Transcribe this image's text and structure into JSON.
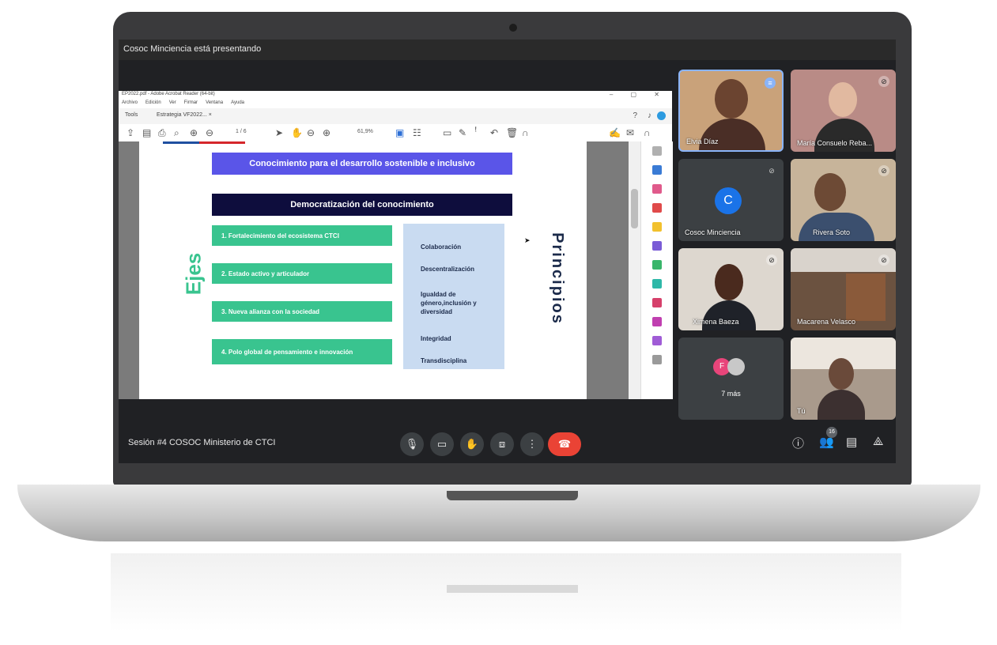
{
  "meet": {
    "presenting_text": "Cosoc Minciencia está presentando",
    "meeting_title": "Sesión #4 COSOC Ministerio de CTCI",
    "people_count": "16"
  },
  "acrobat": {
    "title": "EP2022.pdf - Adobe Acrobat Reader (64-bit)",
    "menu": [
      "Archivo",
      "Edición",
      "Ver",
      "Firmar",
      "Ventana",
      "Ayuda"
    ],
    "tab_tools": "Tools",
    "tab_doc": "Estrategia VF2022... ×",
    "page_counter": "1 / 6",
    "zoom": "61,9%"
  },
  "slide": {
    "banner_top": "Conocimiento para el desarrollo sostenible e inclusivo",
    "banner_dark": "Democratización del conocimiento",
    "ejes_label": "Ejes",
    "principios_label": "Principios",
    "ejes": [
      "1. Fortalecimiento del ecosistema CTCI",
      "2. Estado activo y articulador",
      "3. Nueva alianza con la sociedad",
      "4. Polo global de pensamiento e innovación"
    ],
    "principios": [
      "Colaboración",
      "Descentralización",
      "Igualdad de género,inclusión y diversidad",
      "Integridad",
      "Transdisciplina"
    ]
  },
  "participants": {
    "tile1": "Elvia Díaz",
    "tile2": "María Consuelo Reba...",
    "tile3": "Cosoc Minciencia",
    "tile3_avatar": "C",
    "tile4": "Rivera Soto",
    "tile5": "Ximena Baeza",
    "tile6": "Macarena Velasco",
    "tile7": "7 más",
    "tile7_avatar": "F",
    "tile8": "Tú"
  },
  "colors": {
    "accent_blue": "#5a55e8",
    "dark_navy": "#0e0d3d",
    "eje_green": "#39c48f",
    "principles_bg": "#c9dbf1",
    "end_call_red": "#ea4335",
    "avatar_blue": "#1a73e8",
    "avatar_pink": "#e8457a"
  }
}
